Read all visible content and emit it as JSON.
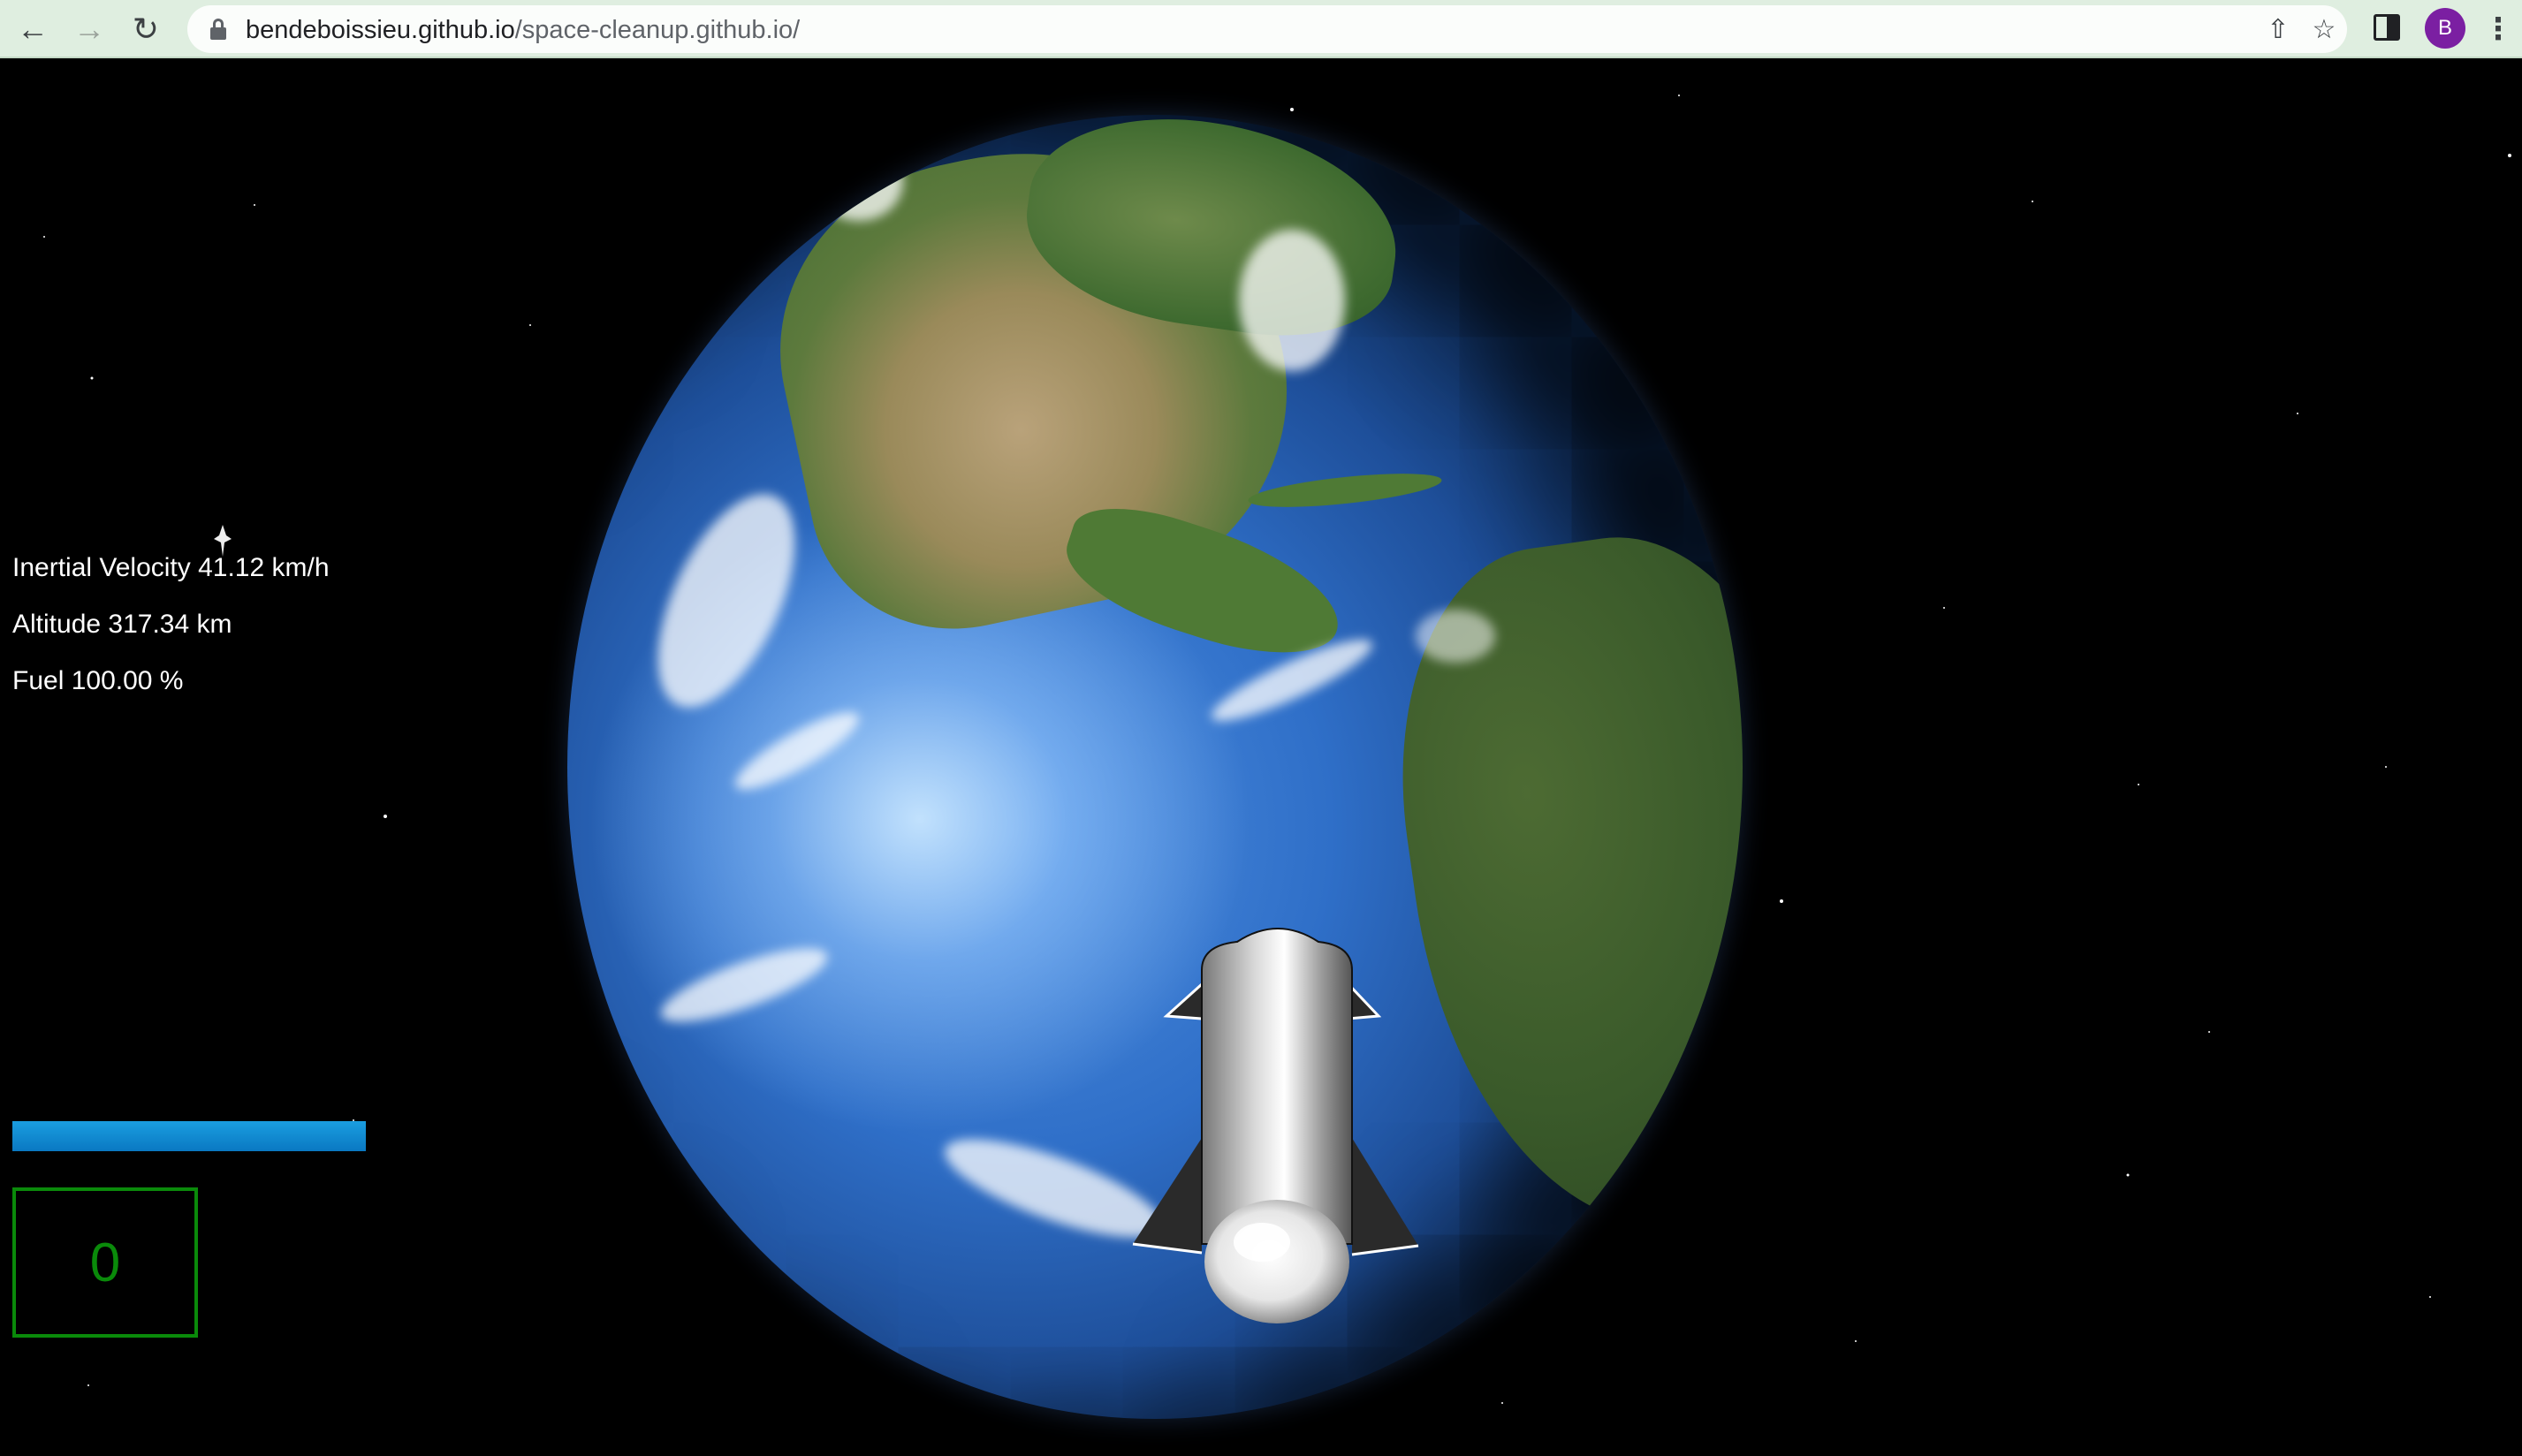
{
  "browser": {
    "back_icon": "back-arrow-icon",
    "forward_icon": "forward-arrow-icon",
    "reload_icon": "reload-icon",
    "url_host": "bendeboissieu.github.io",
    "url_path": "/space-cleanup.github.io/",
    "share_icon": "share-icon",
    "bookmark_icon": "star-icon",
    "side_panel_icon": "side-panel-icon",
    "profile_initial": "B",
    "profile_color": "#7b1fa2",
    "menu_icon": "kebab-menu-icon"
  },
  "hud": {
    "velocity": "Inertial Velocity 41.12 km/h",
    "altitude": "Altitude 317.34 km",
    "fuel": "Fuel 100.00 %",
    "fuel_level": 1.0,
    "fuel_color": "#1a9ee0",
    "score": "0",
    "score_color": "#0a8a0a"
  }
}
